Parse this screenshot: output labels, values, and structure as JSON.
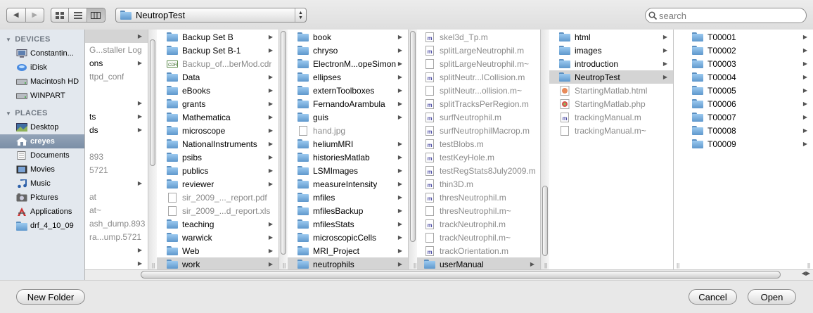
{
  "toolbar": {
    "back_icon": "back-arrow-icon",
    "forward_icon": "forward-arrow-icon",
    "view_modes": [
      "icon-view-icon",
      "list-view-icon",
      "column-view-icon"
    ],
    "path_popup": "NeutropTest",
    "search_placeholder": "search"
  },
  "sidebar": {
    "devices_header": "DEVICES",
    "devices": [
      {
        "label": "Constantin...",
        "icon": "computer-icon"
      },
      {
        "label": "iDisk",
        "icon": "idisk-icon"
      },
      {
        "label": "Macintosh HD",
        "icon": "hard-drive-icon"
      },
      {
        "label": "WINPART",
        "icon": "hard-drive-icon"
      }
    ],
    "places_header": "PLACES",
    "places": [
      {
        "label": "Desktop",
        "icon": "desktop-icon"
      },
      {
        "label": "creyes",
        "icon": "home-icon",
        "selected": true
      },
      {
        "label": "Documents",
        "icon": "documents-icon"
      },
      {
        "label": "Movies",
        "icon": "movies-icon"
      },
      {
        "label": "Music",
        "icon": "music-icon"
      },
      {
        "label": "Pictures",
        "icon": "pictures-icon"
      },
      {
        "label": "Applications",
        "icon": "applications-icon"
      },
      {
        "label": "drf_4_10_09",
        "icon": "folder-icon"
      }
    ]
  },
  "columns": [
    {
      "items": [
        {
          "name": "",
          "arrow": true,
          "selected": true
        },
        {
          "name": "G...staller Log",
          "dim": true
        },
        {
          "name": "ons",
          "arrow": true
        },
        {
          "name": "ttpd_conf",
          "dim": true
        },
        {
          "name": ""
        },
        {
          "name": "",
          "arrow": true
        },
        {
          "name": "ts",
          "arrow": true
        },
        {
          "name": "ds",
          "arrow": true
        },
        {
          "name": ""
        },
        {
          "name": "893",
          "dim": true
        },
        {
          "name": "5721",
          "dim": true
        },
        {
          "name": "",
          "arrow": true
        },
        {
          "name": "at",
          "dim": true
        },
        {
          "name": "at~",
          "dim": true
        },
        {
          "name": "ash_dump.893",
          "dim": true
        },
        {
          "name": "ra...ump.5721",
          "dim": true
        },
        {
          "name": "",
          "arrow": true
        },
        {
          "name": "",
          "arrow": true
        },
        {
          "name": "",
          "arrow": true
        }
      ]
    },
    {
      "items": [
        {
          "name": "Backup Set B",
          "type": "folder",
          "arrow": true
        },
        {
          "name": "Backup Set B-1",
          "type": "folder",
          "arrow": true
        },
        {
          "name": "Backup_of...berMod.cdr",
          "type": "cdr",
          "dim": true
        },
        {
          "name": "Data",
          "type": "folder",
          "arrow": true
        },
        {
          "name": "eBooks",
          "type": "folder",
          "arrow": true
        },
        {
          "name": "grants",
          "type": "folder",
          "arrow": true
        },
        {
          "name": "Mathematica",
          "type": "folder",
          "arrow": true
        },
        {
          "name": "microscope",
          "type": "folder",
          "arrow": true
        },
        {
          "name": "NationalInstruments",
          "type": "folder",
          "arrow": true
        },
        {
          "name": "psibs",
          "type": "folder",
          "arrow": true
        },
        {
          "name": "publics",
          "type": "folder",
          "arrow": true
        },
        {
          "name": "reviewer",
          "type": "folder",
          "arrow": true
        },
        {
          "name": "sir_2009_..._report.pdf",
          "type": "doc",
          "dim": true
        },
        {
          "name": "sir_2009_...d_report.xls",
          "type": "doc",
          "dim": true
        },
        {
          "name": "teaching",
          "type": "folder",
          "arrow": true
        },
        {
          "name": "warwick",
          "type": "folder",
          "arrow": true
        },
        {
          "name": "Web",
          "type": "folder",
          "arrow": true
        },
        {
          "name": "work",
          "type": "folder",
          "arrow": true,
          "selected": true
        }
      ]
    },
    {
      "items": [
        {
          "name": "book",
          "type": "folder",
          "arrow": true
        },
        {
          "name": "chryso",
          "type": "folder",
          "arrow": true
        },
        {
          "name": "ElectronM...opeSimon",
          "type": "folder",
          "arrow": true
        },
        {
          "name": "ellipses",
          "type": "folder",
          "arrow": true
        },
        {
          "name": "externToolboxes",
          "type": "folder",
          "arrow": true
        },
        {
          "name": "FernandoArambula",
          "type": "folder",
          "arrow": true
        },
        {
          "name": "guis",
          "type": "folder",
          "arrow": true
        },
        {
          "name": "hand.jpg",
          "type": "doc",
          "dim": true
        },
        {
          "name": "heliumMRI",
          "type": "folder",
          "arrow": true
        },
        {
          "name": "historiesMatlab",
          "type": "folder",
          "arrow": true
        },
        {
          "name": "LSMImages",
          "type": "folder",
          "arrow": true
        },
        {
          "name": "measureIntensity",
          "type": "folder",
          "arrow": true
        },
        {
          "name": "mfiles",
          "type": "folder",
          "arrow": true
        },
        {
          "name": "mfilesBackup",
          "type": "folder",
          "arrow": true
        },
        {
          "name": "mfilesStats",
          "type": "folder",
          "arrow": true
        },
        {
          "name": "microscopicCells",
          "type": "folder",
          "arrow": true
        },
        {
          "name": "MRI_Project",
          "type": "folder",
          "arrow": true
        },
        {
          "name": "neutrophils",
          "type": "folder",
          "arrow": true,
          "selected": true
        }
      ]
    },
    {
      "items": [
        {
          "name": "skel3d_Tp.m",
          "type": "m",
          "dim": true
        },
        {
          "name": "splitLargeNeutrophil.m",
          "type": "m",
          "dim": true
        },
        {
          "name": "splitLargeNeutrophil.m~",
          "type": "doc",
          "dim": true
        },
        {
          "name": "splitNeutr...lCollision.m",
          "type": "m",
          "dim": true
        },
        {
          "name": "splitNeutr...ollision.m~",
          "type": "doc",
          "dim": true
        },
        {
          "name": "splitTracksPerRegion.m",
          "type": "m",
          "dim": true
        },
        {
          "name": "surfNeutrophil.m",
          "type": "m",
          "dim": true
        },
        {
          "name": "surfNeutrophilMacrop.m",
          "type": "m",
          "dim": true
        },
        {
          "name": "testBlobs.m",
          "type": "m",
          "dim": true
        },
        {
          "name": "testKeyHole.m",
          "type": "m",
          "dim": true
        },
        {
          "name": "testRegStats8July2009.m",
          "type": "m",
          "dim": true
        },
        {
          "name": "thin3D.m",
          "type": "m",
          "dim": true
        },
        {
          "name": "thresNeutrophil.m",
          "type": "m",
          "dim": true
        },
        {
          "name": "thresNeutrophil.m~",
          "type": "doc",
          "dim": true
        },
        {
          "name": "trackNeutrophil.m",
          "type": "m",
          "dim": true
        },
        {
          "name": "trackNeutrophil.m~",
          "type": "doc",
          "dim": true
        },
        {
          "name": "trackOrientation.m",
          "type": "m",
          "dim": true
        },
        {
          "name": "userManual",
          "type": "folder",
          "arrow": true,
          "selected": true
        }
      ]
    },
    {
      "items": [
        {
          "name": "html",
          "type": "folder",
          "arrow": true
        },
        {
          "name": "images",
          "type": "folder",
          "arrow": true
        },
        {
          "name": "introduction",
          "type": "folder",
          "arrow": true
        },
        {
          "name": "NeutropTest",
          "type": "folder",
          "arrow": true,
          "selected": true
        },
        {
          "name": "StartingMatlab.html",
          "type": "html",
          "dim": true
        },
        {
          "name": "StartingMatlab.php",
          "type": "php",
          "dim": true
        },
        {
          "name": "trackingManual.m",
          "type": "m",
          "dim": true
        },
        {
          "name": "trackingManual.m~",
          "type": "doc",
          "dim": true
        }
      ]
    },
    {
      "items": [
        {
          "name": "T00001",
          "type": "folder",
          "arrow": true
        },
        {
          "name": "T00002",
          "type": "folder",
          "arrow": true
        },
        {
          "name": "T00003",
          "type": "folder",
          "arrow": true
        },
        {
          "name": "T00004",
          "type": "folder",
          "arrow": true
        },
        {
          "name": "T00005",
          "type": "folder",
          "arrow": true
        },
        {
          "name": "T00006",
          "type": "folder",
          "arrow": true
        },
        {
          "name": "T00007",
          "type": "folder",
          "arrow": true
        },
        {
          "name": "T00008",
          "type": "folder",
          "arrow": true
        },
        {
          "name": "T00009",
          "type": "folder",
          "arrow": true
        }
      ]
    }
  ],
  "buttons": {
    "new_folder": "New Folder",
    "cancel": "Cancel",
    "open": "Open"
  }
}
